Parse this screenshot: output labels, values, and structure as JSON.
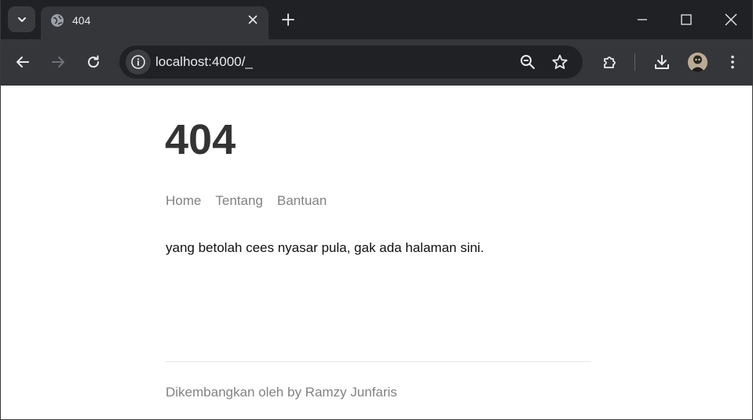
{
  "browser": {
    "tab": {
      "title": "404"
    },
    "address_bar": {
      "url": "localhost:4000/_"
    }
  },
  "page": {
    "title": "404",
    "nav": [
      "Home",
      "Tentang",
      "Bantuan"
    ],
    "message": "yang betolah cees nyasar pula, gak ada halaman sini.",
    "footer": "Dikembangkan oleh by Ramzy Junfaris"
  },
  "icons": {
    "tab_search": "chevron-down-icon",
    "favicon": "globe-icon",
    "tab_close": "close-icon",
    "new_tab": "plus-icon",
    "minimize": "minimize-icon",
    "maximize": "maximize-icon",
    "close_window": "close-icon",
    "back": "back-arrow-icon",
    "forward": "forward-arrow-icon",
    "reload": "reload-icon",
    "site_info": "info-icon",
    "zoom": "zoom-out-icon",
    "bookmark": "star-icon",
    "extensions": "puzzle-icon",
    "downloads": "download-icon",
    "menu": "kebab-menu-icon"
  },
  "colors": {
    "chrome_dark": "#202124",
    "chrome_toolbar": "#35363a",
    "heading": "#333333",
    "nav_link": "#828282",
    "body_text": "#111111"
  }
}
